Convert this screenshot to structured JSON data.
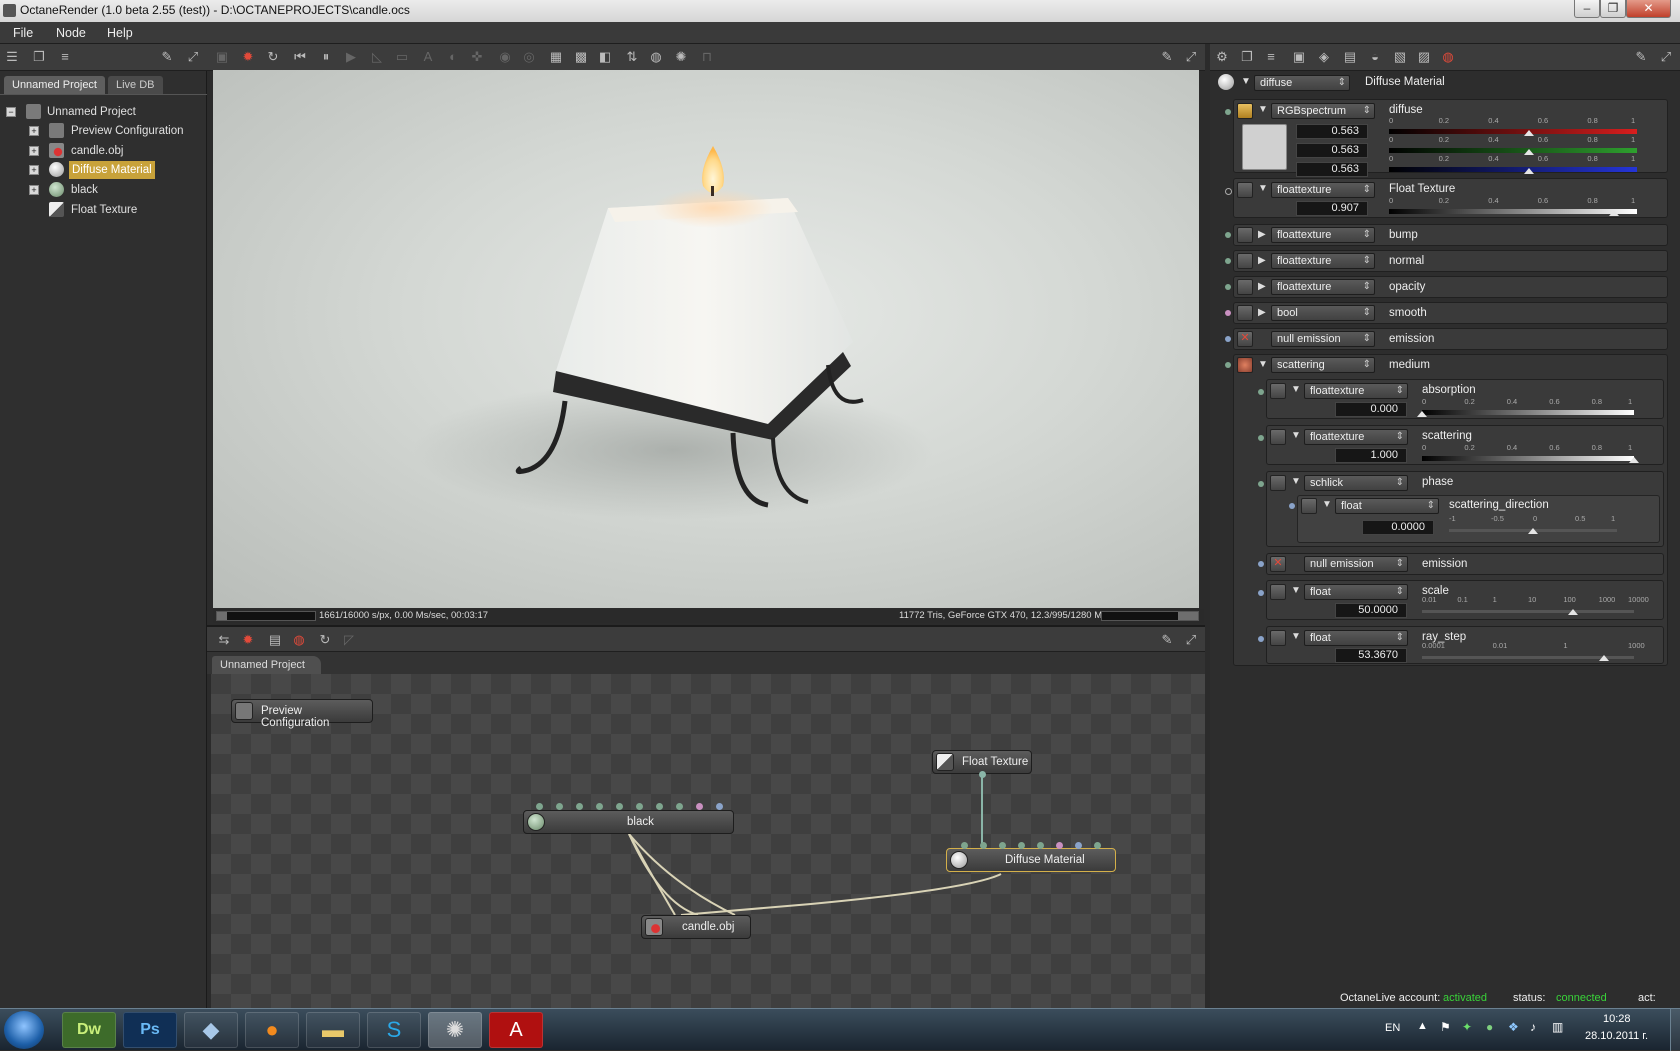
{
  "window": {
    "title": "OctaneRender (1.0 beta 2.55 (test)) - D:\\OCTANEPROJECTS\\candle.ocs"
  },
  "menu": [
    "File",
    "Node",
    "Help"
  ],
  "scene_tabs": [
    "Unnamed Project",
    "Live DB"
  ],
  "tree": {
    "root": "Unnamed Project",
    "items": [
      "Preview Configuration",
      "candle.obj",
      "Diffuse Material",
      "black",
      "Float Texture"
    ]
  },
  "render": {
    "stats_left": "1661/16000 s/px, 0.00 Ms/sec, 00:03:17",
    "stats_right": "11772 Tris, GeForce GTX 470, 12.3/995/1280 MB",
    "progress": 0.104
  },
  "graph": {
    "tab": "Unnamed Project",
    "nodes": {
      "preview": "Preview Configuration",
      "float_texture": "Float Texture",
      "black": "black",
      "diffuse": "Diffuse Material",
      "candle": "candle.obj"
    }
  },
  "inspector": {
    "header": {
      "type": "diffuse",
      "name": "Diffuse Material"
    },
    "diffuse": {
      "type": "RGBspectrum",
      "label": "diffuse",
      "r": "0.563",
      "g": "0.563",
      "b": "0.563",
      "ticks": [
        "0",
        "0.2",
        "0.4",
        "0.6",
        "0.8",
        "1"
      ],
      "fraction": 0.563,
      "colors": {
        "r": "#d81e1e",
        "g": "#2ea02e",
        "b": "#2535d8"
      }
    },
    "float_texture": {
      "type": "floattexture",
      "label": "Float Texture",
      "value": "0.907",
      "fraction": 0.907
    },
    "bump": {
      "type": "floattexture",
      "label": "bump"
    },
    "normal": {
      "type": "floattexture",
      "label": "normal"
    },
    "opacity": {
      "type": "floattexture",
      "label": "opacity"
    },
    "smooth": {
      "type": "bool",
      "label": "smooth"
    },
    "emission": {
      "type": "null emission",
      "label": "emission"
    },
    "medium": {
      "type": "scattering",
      "label": "medium",
      "absorption": {
        "type": "floattexture",
        "label": "absorption",
        "value": "0.000",
        "fraction": 0.0
      },
      "scattering": {
        "type": "floattexture",
        "label": "scattering",
        "value": "1.000",
        "fraction": 1.0
      },
      "phase": {
        "type": "schlick",
        "label": "phase"
      },
      "scattering_direction": {
        "type": "float",
        "label": "scattering_direction",
        "value": "0.0000",
        "ticks": [
          "-1",
          "-0.5",
          "0",
          "0.5",
          "1"
        ],
        "fraction": 0.5
      },
      "emission": {
        "type": "null emission",
        "label": "emission"
      },
      "scale": {
        "type": "float",
        "label": "scale",
        "value": "50.0000",
        "ticks": [
          "0.01",
          "0.1",
          "1",
          "10",
          "100",
          "1000",
          "10000"
        ],
        "fraction": 0.71
      },
      "ray_step": {
        "type": "float",
        "label": "ray_step",
        "value": "53.3670",
        "ticks": [
          "0.0001",
          "0.01",
          "1",
          "1000"
        ],
        "fraction": 0.86
      }
    }
  },
  "status": {
    "account_label": "OctaneLive account:",
    "account_value": "activated",
    "status_label": "status:",
    "status_value": "connected",
    "act_label": "act:"
  },
  "taskbar": {
    "lang": "EN",
    "time": "10:28",
    "date": "28.10.2011 г."
  }
}
